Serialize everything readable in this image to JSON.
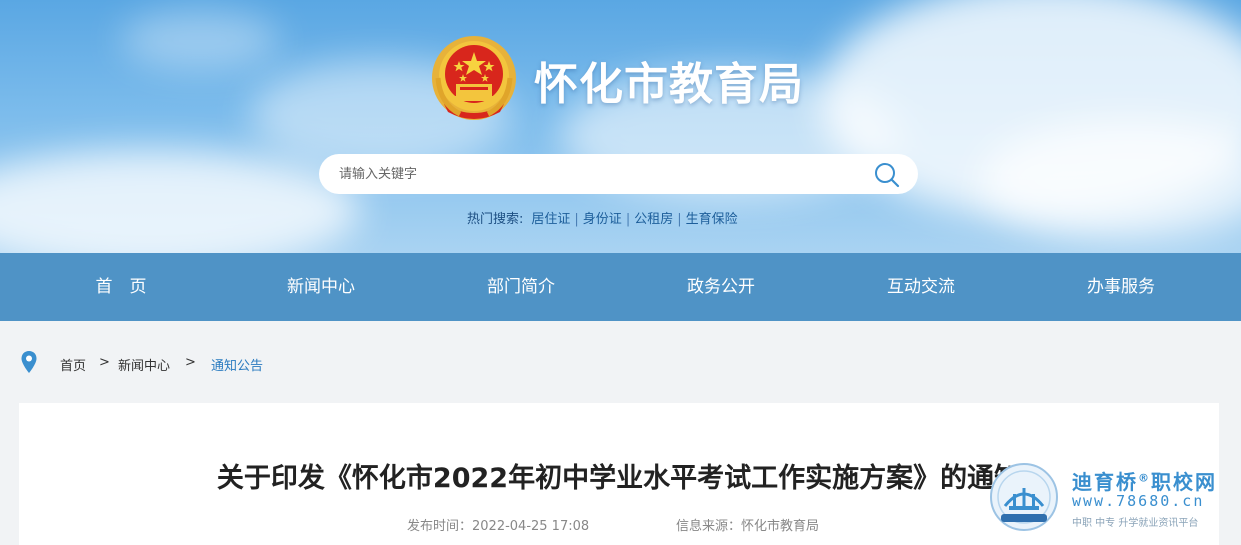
{
  "site": {
    "title": "怀化市教育局"
  },
  "search": {
    "placeholder": "请输入关键字",
    "hot_label": "热门搜索:",
    "hot_terms": [
      "居住证",
      "身份证",
      "公租房",
      "生育保险"
    ],
    "separator": "|"
  },
  "nav": {
    "items": [
      {
        "label": "首　页"
      },
      {
        "label": "新闻中心"
      },
      {
        "label": "部门简介"
      },
      {
        "label": "政务公开"
      },
      {
        "label": "互动交流"
      },
      {
        "label": "办事服务"
      }
    ]
  },
  "breadcrumb": {
    "items": [
      "首页",
      "新闻中心",
      "通知公告"
    ],
    "separator": ">"
  },
  "article": {
    "title": "关于印发《怀化市2022年初中学业水平考试工作实施方案》的通知",
    "publish_time": "发布时间：2022-04-25 17:08",
    "source": "信息来源：怀化市教育局"
  },
  "watermark": {
    "name": "迪育桥",
    "registered": "®",
    "suffix": "职校网",
    "url": "www.78680.cn",
    "slogan": "中职 中专 升学就业资讯平台"
  },
  "colors": {
    "nav_bg": "#4f93c6",
    "link_active": "#2a7bc0",
    "emblem_red": "#d8261c",
    "emblem_gold": "#f3c53d"
  }
}
